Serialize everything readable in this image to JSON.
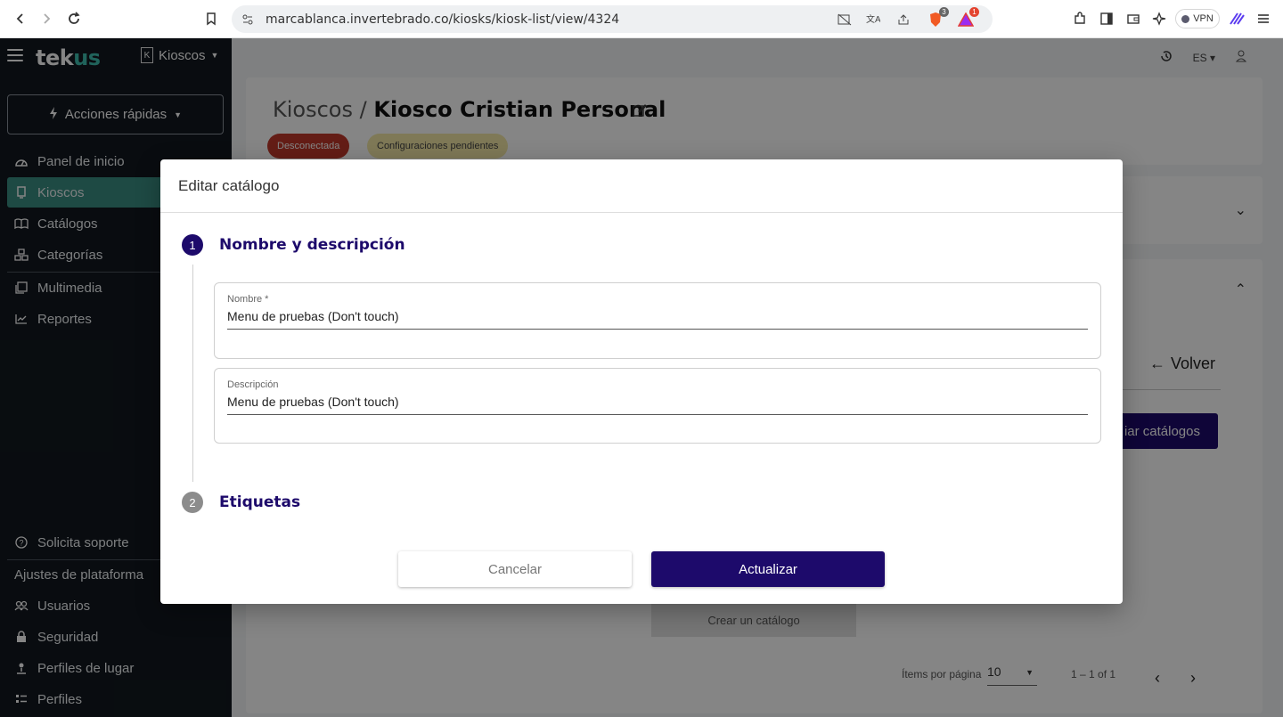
{
  "browser": {
    "url": "marcablanca.invertebrado.co/kiosks/kiosk-list/view/4324",
    "brave_badge": "3",
    "alert_badge": "1",
    "vpn_label": "VPN"
  },
  "sidebar": {
    "logo_main": "tek",
    "logo_accent": "us",
    "kiosk_switch": "Kioscos",
    "kiosk_letter": "K",
    "quick_actions": "Acciones rápidas",
    "items": [
      {
        "label": "Panel de inicio",
        "icon": "dashboard-icon"
      },
      {
        "label": "Kioscos",
        "icon": "kiosk-icon",
        "active": true
      },
      {
        "label": "Catálogos",
        "icon": "book-icon"
      },
      {
        "label": "Categorías",
        "icon": "categories-icon"
      },
      {
        "label": "Multimedia",
        "icon": "media-icon"
      },
      {
        "label": "Reportes",
        "icon": "chart-icon"
      }
    ],
    "support": "Solicita soporte",
    "settings_heading": "Ajustes de plataforma",
    "settings_items": [
      {
        "label": "Usuarios",
        "icon": "users-icon"
      },
      {
        "label": "Seguridad",
        "icon": "lock-icon"
      },
      {
        "label": "Perfiles de lugar",
        "icon": "place-icon"
      },
      {
        "label": "Perfiles",
        "icon": "profiles-icon"
      }
    ]
  },
  "topbar": {
    "language": "ES"
  },
  "header": {
    "breadcrumb_parent": "Kioscos",
    "separator": "/",
    "title": "Kiosco Cristian Personal",
    "status_disconnected": "Desconectada",
    "status_pending": "Configuraciones pendientes"
  },
  "catalog_panel": {
    "back_label": "Volver",
    "manage_button": "iar catálogos",
    "create_button": "Crear un catálogo",
    "items_per_page_label": "Ítems por página",
    "items_per_page_value": "10",
    "range": "1 – 1 of 1"
  },
  "dialog": {
    "title": "Editar catálogo",
    "steps": [
      {
        "number": "1",
        "label": "Nombre y descripción"
      },
      {
        "number": "2",
        "label": "Etiquetas"
      }
    ],
    "fields": {
      "name_label": "Nombre *",
      "name_value": "Menu de pruebas (Don't touch)",
      "description_label": "Descripción",
      "description_value": "Menu de pruebas (Don't touch)"
    },
    "cancel_label": "Cancelar",
    "update_label": "Actualizar"
  },
  "colors": {
    "primary": "#1d0a6b",
    "sidebar_bg": "#12181f",
    "sidebar_active": "#3a8f82",
    "status_red": "#c0392b",
    "status_yellow": "#f3e9a8"
  }
}
